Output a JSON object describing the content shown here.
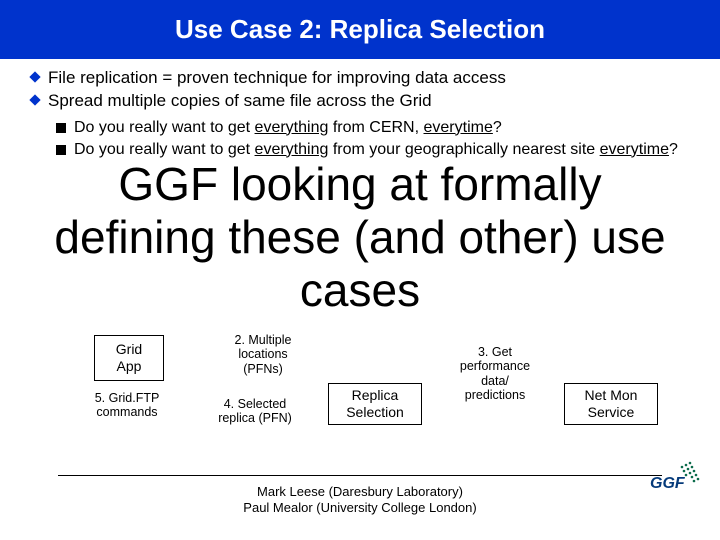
{
  "title": "Use Case 2: Replica Selection",
  "bullets": {
    "b1": "File replication = proven technique for improving data access",
    "b2": "Spread multiple copies of same file across the Grid"
  },
  "sub_bullets": {
    "s1_pre": "Do you really want to get ",
    "s1_u1": "everything",
    "s1_mid": " from CERN, ",
    "s1_u2": "everytime",
    "s1_post": "?",
    "s2_pre": "Do you really want to get ",
    "s2_u1": "everything",
    "s2_mid": " from your geographically nearest site ",
    "s2_u2": "everytime",
    "s2_post": "?"
  },
  "overlay": {
    "l1": "GGF looking at formally",
    "l2": "defining these (and other) use",
    "l3": "cases"
  },
  "diagram": {
    "grid_app_l1": "Grid",
    "grid_app_l2": "App",
    "step5_l1": "5. Grid.FTP",
    "step5_l2": "commands",
    "step2_l1": "2. Multiple",
    "step2_l2": "locations",
    "step2_l3": "(PFNs)",
    "step4_l1": "4. Selected",
    "step4_l2": "replica (PFN)",
    "repsel_l1": "Replica",
    "repsel_l2": "Selection",
    "step3_l1": "3. Get",
    "step3_l2": "performance",
    "step3_l3": "data/",
    "step3_l4": "predictions",
    "netmon_l1": "Net Mon",
    "netmon_l2": "Service"
  },
  "footer": {
    "l1": "Mark Leese (Daresbury Laboratory)",
    "l2": "Paul Mealor (University College London)"
  },
  "logo_alt": "GGF"
}
